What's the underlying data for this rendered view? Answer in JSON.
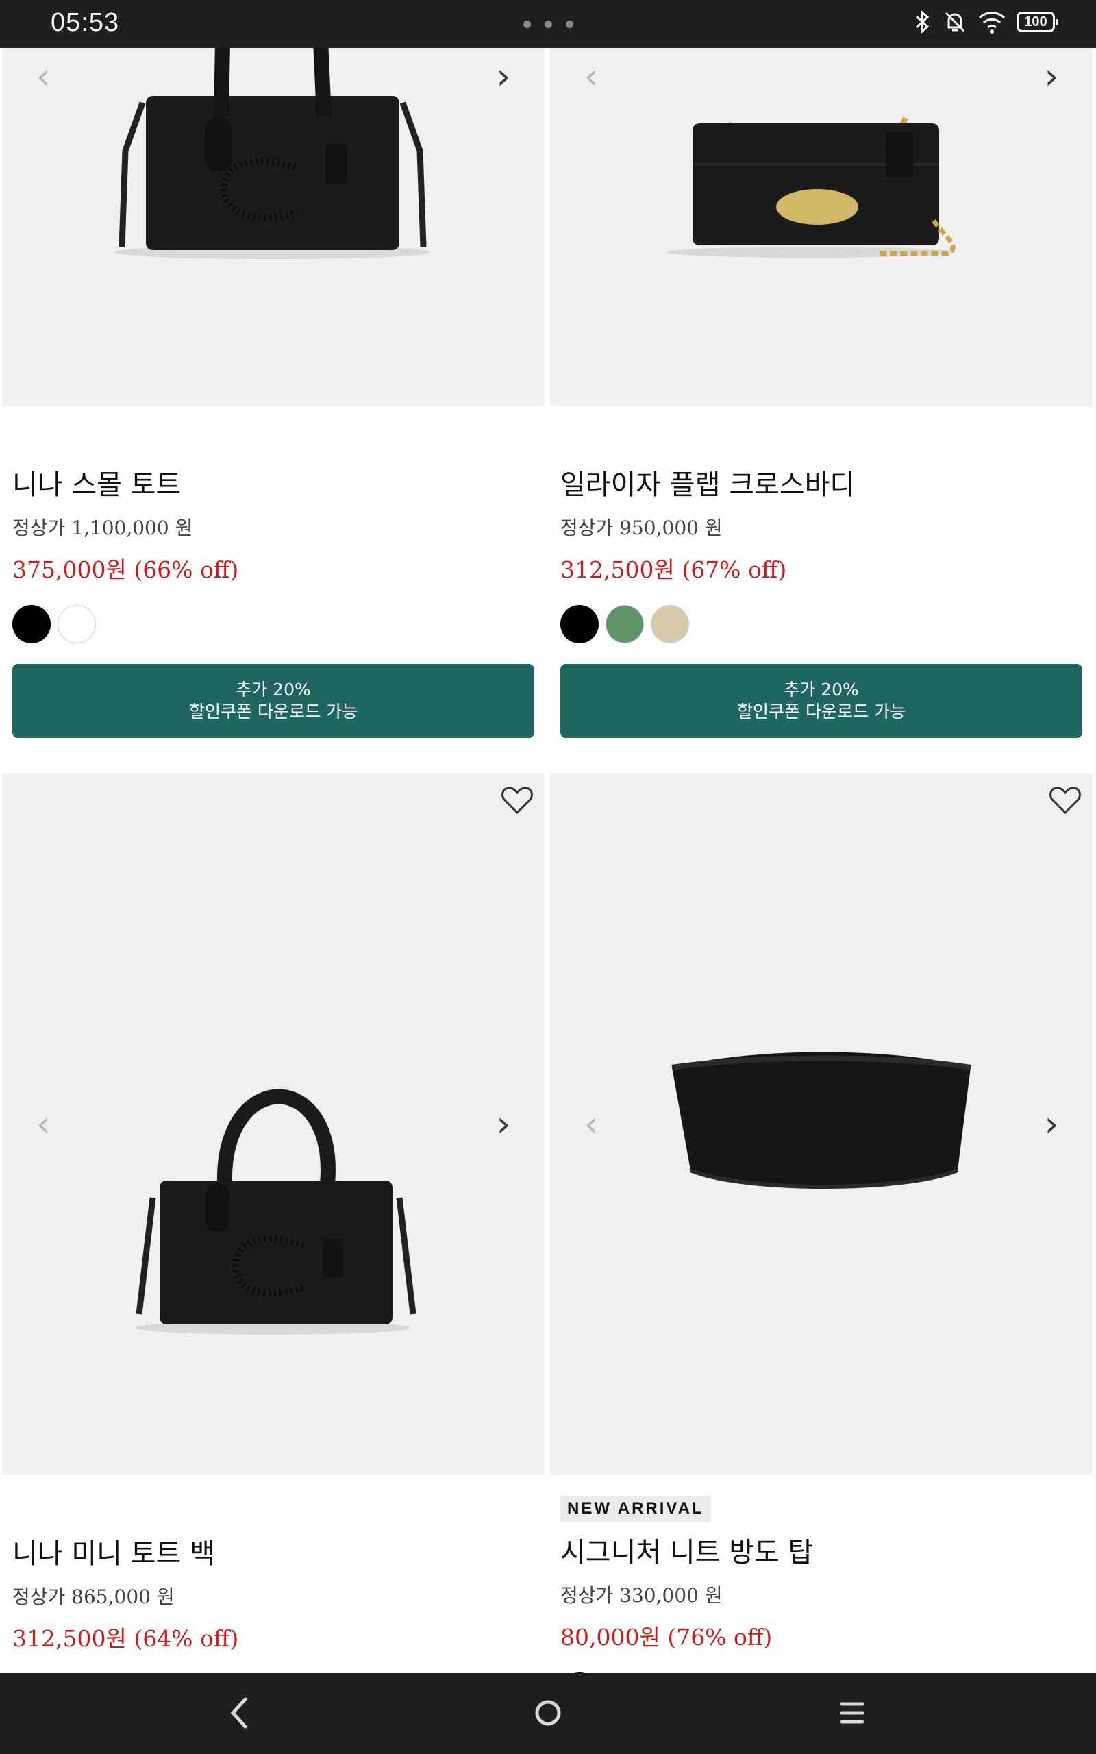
{
  "status_bar": {
    "time": "05:53",
    "battery": "100"
  },
  "products": [
    {
      "name": "니나 스몰 토트",
      "regular_price": "정상가 1,100,000 원",
      "sale_price": "375,000원 (66% off)",
      "badge": "",
      "swatches": [
        "#000000",
        "#ffffff"
      ],
      "coupon_line1": "추가 20%",
      "coupon_line2": "할인쿠폰 다운로드 가능",
      "image_icon": "handbag-tote"
    },
    {
      "name": "일라이자 플랩 크로스바디",
      "regular_price": "정상가 950,000 원",
      "sale_price": "312,500원 (67% off)",
      "badge": "",
      "swatches": [
        "#000000",
        "#5f9468",
        "#d8cbaa"
      ],
      "coupon_line1": "추가 20%",
      "coupon_line2": "할인쿠폰 다운로드 가능",
      "image_icon": "flap-crossbody"
    },
    {
      "name": "니나 미니 토트 백",
      "regular_price": "정상가 865,000 원",
      "sale_price": "312,500원 (64% off)",
      "badge": "",
      "swatches": [
        "#000000",
        "#ffffff",
        "#ffffff"
      ],
      "image_icon": "mini-tote"
    },
    {
      "name": "시그니처 니트 방도 탑",
      "regular_price": "정상가 330,000 원",
      "sale_price": "80,000원 (76% off)",
      "badge": "NEW ARRIVAL",
      "swatches": [
        "#000000"
      ],
      "image_icon": "bandeau-top"
    }
  ],
  "icons": {
    "wishlist": "heart-outline-icon",
    "prev": "chevron-left-icon",
    "next": "chevron-right-icon",
    "nav_back": "back-icon",
    "nav_home": "home-icon",
    "nav_menu": "menu-icon"
  },
  "colors": {
    "sale": "#d01a1a",
    "coupon_bg": "#1f6661",
    "image_bg": "#f0f0f0",
    "system_bar": "#1f1f22"
  }
}
